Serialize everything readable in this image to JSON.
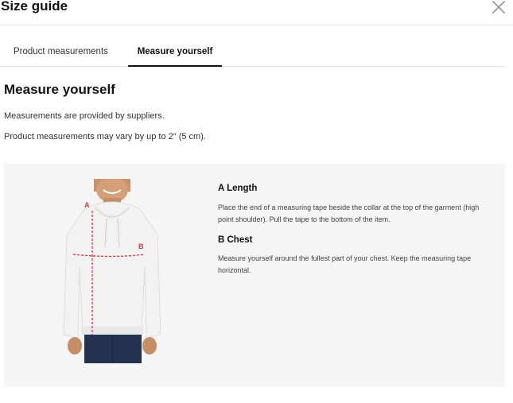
{
  "header": {
    "title": "Size guide",
    "close_icon": "close-icon"
  },
  "tabs": [
    {
      "label": "Product measurements",
      "active": false
    },
    {
      "label": "Measure yourself",
      "active": true
    }
  ],
  "content": {
    "heading": "Measure yourself",
    "note1": "Measurements are provided by suppliers.",
    "note2": "Product measurements may vary by up to 2\" (5 cm).",
    "figure": {
      "markers": [
        "A",
        "B"
      ],
      "accent_color": "#e03232"
    },
    "sections": [
      {
        "title": "A Length",
        "desc": "Place the end of a measuring tape beside the collar at the top of the garment (high point shoulder). Pull the tape to the bottom of the item."
      },
      {
        "title": "B Chest",
        "desc": "Measure yourself around the fullest part of your chest. Keep the measuring tape horizontal."
      }
    ]
  },
  "colors": {
    "panel_bg": "#f5f5f5",
    "divider": "#e6e6e6",
    "active_tab_underline": "#111111"
  }
}
